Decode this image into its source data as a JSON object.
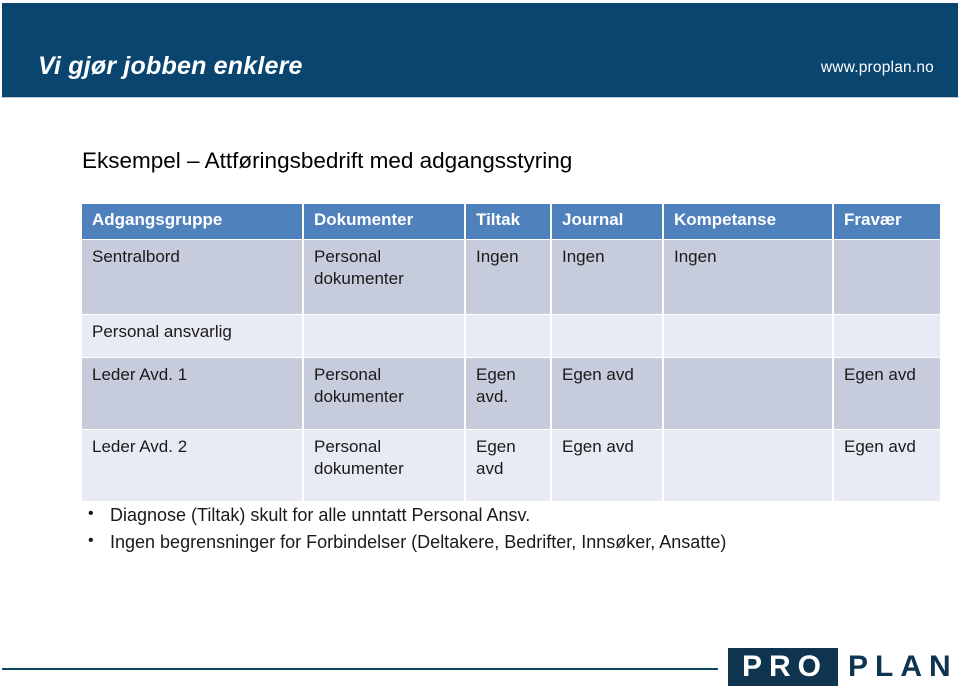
{
  "banner": {
    "tagline": "Vi gjør jobben enklere",
    "url": "www.proplan.no"
  },
  "slide": {
    "title": "Eksempel – Attføringsbedrift med adgangsstyring"
  },
  "table": {
    "headers": [
      "Adgangsgruppe",
      "Dokumenter",
      "Tiltak",
      "Journal",
      "Kompetanse",
      "Fravær"
    ],
    "rows": [
      {
        "cells": [
          "Sentralbord",
          "Personal dokumenter",
          "Ingen",
          "Ingen",
          "Ingen",
          ""
        ]
      },
      {
        "cells": [
          "Personal ansvarlig",
          "",
          "",
          "",
          "",
          ""
        ]
      },
      {
        "cells": [
          "Leder Avd. 1",
          "Personal dokumenter",
          "Egen avd.",
          "Egen avd",
          "",
          "Egen avd"
        ]
      },
      {
        "cells": [
          "Leder Avd. 2",
          "Personal dokumenter",
          "Egen avd",
          "Egen avd",
          "",
          "Egen avd"
        ]
      }
    ]
  },
  "bullets": {
    "marker": "•",
    "items": [
      "Diagnose (Tiltak) skult for alle unntatt Personal Ansv.",
      "Ingen begrensninger for Forbindelser (Deltakere, Bedrifter, Innsøker, Ansatte)"
    ]
  },
  "footer": {
    "logo_part1": "PRO",
    "logo_part2": "PLAN"
  },
  "colors": {
    "banner_navy": "#09456F",
    "table_header_blue": "#4F81BD",
    "row_band_dark": "#C7CCDD",
    "row_band_light": "#E8EBF3",
    "logo_navy": "#0F3450",
    "footer_rule": "#0A4560"
  }
}
